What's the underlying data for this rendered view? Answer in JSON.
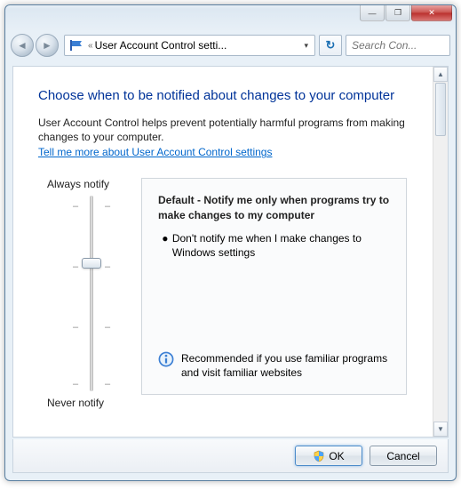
{
  "titlebar": {
    "min_icon": "—",
    "max_icon": "❐",
    "close_icon": "✕"
  },
  "toolbar": {
    "back_icon": "◄",
    "fwd_icon": "►",
    "breadcrumb_sep": "«",
    "address_text": "User Account Control setti...",
    "dropdown_icon": "▾",
    "refresh_icon": "↻",
    "search_placeholder": "Search Con..."
  },
  "page": {
    "heading": "Choose when to be notified about changes to your computer",
    "description": "User Account Control helps prevent potentially harmful programs from making changes to your computer.",
    "link_text": "Tell me more about User Account Control settings"
  },
  "slider": {
    "top_label": "Always notify",
    "bottom_label": "Never notify",
    "levels": 4,
    "current_level": 1,
    "tick_char": "–"
  },
  "info": {
    "title": "Default - Notify me only when programs try to make changes to my computer",
    "bullet": "Don't notify me when I make changes to Windows settings",
    "recommendation": "Recommended if you use familiar programs and visit familiar websites"
  },
  "buttons": {
    "ok": "OK",
    "cancel": "Cancel"
  }
}
